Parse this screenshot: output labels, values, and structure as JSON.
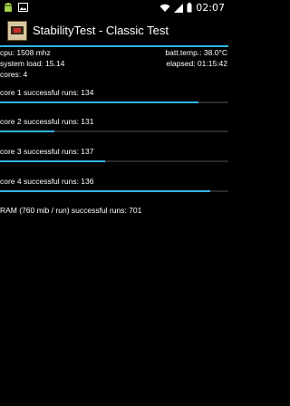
{
  "status_bar": {
    "time": "02:07",
    "icons": [
      "android-icon",
      "image-icon",
      "wifi-icon",
      "signal-icon",
      "battery-icon"
    ]
  },
  "header": {
    "title": "StabilityTest - Classic Test",
    "icon": "app-icon",
    "accent": "#33b5e5"
  },
  "stats": {
    "cpu": "cpu: 1508 mhz",
    "batt_temp": "batt.temp.: 38.0°C",
    "system_load": "system load: 15.14",
    "elapsed": "elapsed: 01:15:42",
    "cores": "cores: 4"
  },
  "cores": [
    {
      "label": "core 1 successful runs: 134",
      "progress": 0.87
    },
    {
      "label": "core 2 successful runs: 131",
      "progress": 0.24
    },
    {
      "label": "core 3 successful runs: 137",
      "progress": 0.46
    },
    {
      "label": "core 4 successful runs: 136",
      "progress": 0.92
    }
  ],
  "ram": {
    "label": "RAM (760 mib / run) successful runs: 701"
  }
}
